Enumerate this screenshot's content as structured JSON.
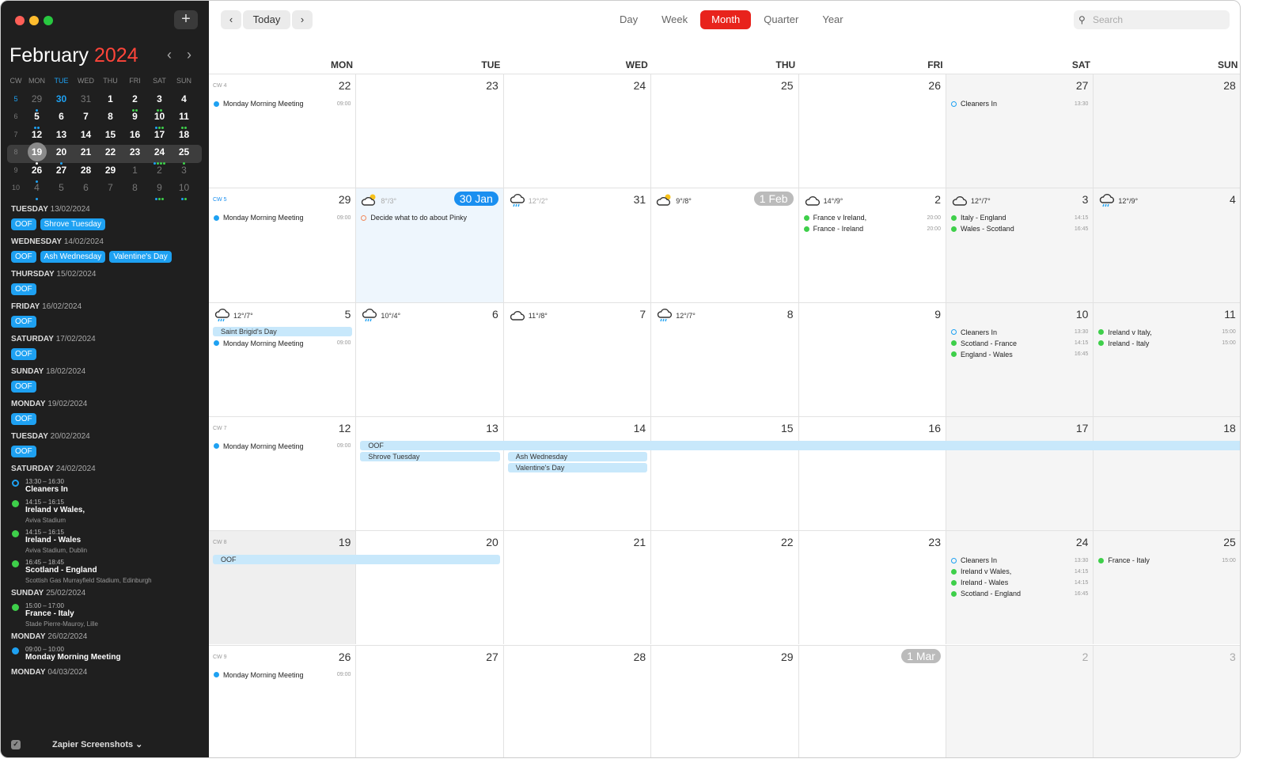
{
  "colors": {
    "accent": "#e8231c",
    "blue": "#1ea1f2",
    "green": "#3ecf4a",
    "orange": "#f08a5d",
    "bar": "#c8e8fb"
  },
  "sidebar": {
    "add_icon": "plus-icon",
    "add_label": "+",
    "month": "February",
    "year": "2024",
    "prev": "‹",
    "next": "›",
    "mini_headers": [
      "CW",
      "MON",
      "TUE",
      "WED",
      "THU",
      "FRI",
      "SAT",
      "SUN"
    ],
    "mini_weeks": [
      {
        "cw": "5",
        "cur": true,
        "days": [
          {
            "n": "29",
            "dim": true,
            "dots": "b"
          },
          {
            "n": "30",
            "cur": true,
            "dots": ""
          },
          {
            "n": "31",
            "dim": true
          },
          {
            "n": "1"
          },
          {
            "n": "2",
            "dots": "gg"
          },
          {
            "n": "3",
            "dots": "gg"
          },
          {
            "n": "4"
          }
        ]
      },
      {
        "cw": "6",
        "days": [
          {
            "n": "5",
            "dots": "bb"
          },
          {
            "n": "6"
          },
          {
            "n": "7"
          },
          {
            "n": "8"
          },
          {
            "n": "9"
          },
          {
            "n": "10",
            "dots": "bgg"
          },
          {
            "n": "11",
            "dots": "gg"
          }
        ]
      },
      {
        "cw": "7",
        "days": [
          {
            "n": "12",
            "dots": "g"
          },
          {
            "n": "13",
            "dots": "bb"
          },
          {
            "n": "14",
            "dots": "bbb"
          },
          {
            "n": "15",
            "dots": "b"
          },
          {
            "n": "16",
            "dots": "b"
          },
          {
            "n": "17",
            "dots": "b"
          },
          {
            "n": "18",
            "dots": "b"
          }
        ]
      },
      {
        "cw": "8",
        "sel": true,
        "days": [
          {
            "n": "19",
            "today": true,
            "dots": "w"
          },
          {
            "n": "20",
            "dots": "b"
          },
          {
            "n": "21"
          },
          {
            "n": "22"
          },
          {
            "n": "23"
          },
          {
            "n": "24",
            "dots": "bggg"
          },
          {
            "n": "25",
            "dots": "g"
          }
        ]
      },
      {
        "cw": "9",
        "days": [
          {
            "n": "26",
            "dots": "b"
          },
          {
            "n": "27"
          },
          {
            "n": "28"
          },
          {
            "n": "29"
          },
          {
            "n": "1",
            "dim": true
          },
          {
            "n": "2",
            "dim": true
          },
          {
            "n": "3",
            "dim": true
          }
        ]
      },
      {
        "cw": "10",
        "days": [
          {
            "n": "4",
            "dim": true,
            "dots": "b"
          },
          {
            "n": "5",
            "dim": true
          },
          {
            "n": "6",
            "dim": true
          },
          {
            "n": "7",
            "dim": true
          },
          {
            "n": "8",
            "dim": true
          },
          {
            "n": "9",
            "dim": true,
            "dots": "bgg"
          },
          {
            "n": "10",
            "dim": true,
            "dots": "bg"
          }
        ]
      }
    ],
    "agenda": [
      {
        "day": "TUESDAY",
        "date": "13/02/2024",
        "chips": [
          "OOF",
          "Shrove Tuesday"
        ]
      },
      {
        "day": "WEDNESDAY",
        "date": "14/02/2024",
        "chips": [
          "OOF",
          "Ash Wednesday",
          "Valentine's Day"
        ]
      },
      {
        "day": "THURSDAY",
        "date": "15/02/2024",
        "chips": [
          "OOF"
        ]
      },
      {
        "day": "FRIDAY",
        "date": "16/02/2024",
        "chips": [
          "OOF"
        ]
      },
      {
        "day": "SATURDAY",
        "date": "17/02/2024",
        "chips": [
          "OOF"
        ]
      },
      {
        "day": "SUNDAY",
        "date": "18/02/2024",
        "chips": [
          "OOF"
        ]
      },
      {
        "day": "MONDAY",
        "date": "19/02/2024",
        "chips": [
          "OOF"
        ]
      },
      {
        "day": "TUESDAY",
        "date": "20/02/2024",
        "chips": [
          "OOF"
        ]
      },
      {
        "day": "SATURDAY",
        "date": "24/02/2024",
        "events": [
          {
            "time": "13:30 – 16:30",
            "title": "Cleaners In",
            "color": "blue",
            "ring": true
          },
          {
            "time": "14:15 – 16:15",
            "title": "Ireland v Wales,",
            "loc": "Aviva Stadium",
            "color": "green"
          },
          {
            "time": "14:15 – 16:15",
            "title": "Ireland - Wales",
            "loc": "Aviva Stadium, Dublin",
            "color": "green"
          },
          {
            "time": "16:45 – 18:45",
            "title": "Scotland - England",
            "loc": "Scottish Gas Murrayfield Stadium, Edinburgh",
            "color": "green"
          }
        ]
      },
      {
        "day": "SUNDAY",
        "date": "25/02/2024",
        "events": [
          {
            "time": "15:00 – 17:00",
            "title": "France - Italy",
            "loc": "Stade Pierre-Mauroy, Lille",
            "color": "green"
          }
        ]
      },
      {
        "day": "MONDAY",
        "date": "26/02/2024",
        "events": [
          {
            "time": "09:00 – 10:00",
            "title": "Monday Morning Meeting",
            "color": "blue"
          }
        ]
      },
      {
        "day": "MONDAY",
        "date": "04/03/2024"
      }
    ],
    "calendar_name": "Zapier Screenshots ⌄"
  },
  "toolbar": {
    "prev": "‹",
    "today": "Today",
    "next": "›",
    "views": [
      "Day",
      "Week",
      "Month",
      "Quarter",
      "Year"
    ],
    "active_view": "Month",
    "search_placeholder": "Search",
    "search_icon": "search-icon"
  },
  "weekdays": [
    "MON",
    "TUE",
    "WED",
    "THU",
    "FRI",
    "SAT",
    "SUN"
  ],
  "weeks": [
    {
      "cw": "CW 4",
      "cells": [
        {
          "n": "22",
          "events": [
            {
              "title": "Monday Morning Meeting",
              "time": "09:00",
              "color": "blue"
            }
          ]
        },
        {
          "n": "23"
        },
        {
          "n": "24"
        },
        {
          "n": "25"
        },
        {
          "n": "26"
        },
        {
          "n": "27",
          "events": [
            {
              "title": "Cleaners In",
              "time": "13:30",
              "color": "blue",
              "ring": true
            }
          ]
        },
        {
          "n": "28"
        }
      ]
    },
    {
      "cw": "CW 5",
      "cur": true,
      "cells": [
        {
          "n": "29",
          "events": [
            {
              "title": "Monday Morning Meeting",
              "time": "09:00",
              "color": "blue"
            }
          ]
        },
        {
          "n": "30 Jan",
          "badge": "blue",
          "today": true,
          "wx": {
            "icon": "partly-sunny",
            "temp": "8°/3°",
            "dim": true
          },
          "events": [
            {
              "title": "Decide what to do about Pinky",
              "color": "orange",
              "ring": true
            }
          ]
        },
        {
          "n": "31",
          "wx": {
            "icon": "rain",
            "temp": "12°/2°",
            "dim": true
          }
        },
        {
          "n": "1 Feb",
          "badge": "gray",
          "wx": {
            "icon": "partly-sunny",
            "temp": "9°/8°"
          }
        },
        {
          "n": "2",
          "wx": {
            "icon": "cloud",
            "temp": "14°/9°"
          },
          "events": [
            {
              "title": "France v Ireland,",
              "time": "20:00",
              "color": "green"
            },
            {
              "title": "France - Ireland",
              "time": "20:00",
              "color": "green"
            }
          ]
        },
        {
          "n": "3",
          "wx": {
            "icon": "cloud",
            "temp": "12°/7°"
          },
          "events": [
            {
              "title": "Italy - England",
              "time": "14:15",
              "color": "green"
            },
            {
              "title": "Wales - Scotland",
              "time": "16:45",
              "color": "green"
            }
          ]
        },
        {
          "n": "4",
          "wx": {
            "icon": "rain",
            "temp": "12°/9°"
          }
        }
      ]
    },
    {
      "cw": "",
      "cells": [
        {
          "n": "5",
          "wx": {
            "icon": "rain",
            "temp": "12°/7°"
          },
          "skip": 1,
          "events": [
            {
              "title": "Monday Morning Meeting",
              "time": "09:00",
              "color": "blue"
            }
          ]
        },
        {
          "n": "6",
          "wx": {
            "icon": "rain",
            "temp": "10°/4°"
          }
        },
        {
          "n": "7",
          "wx": {
            "icon": "cloud",
            "temp": "11°/8°"
          }
        },
        {
          "n": "8",
          "wx": {
            "icon": "rain",
            "temp": "12°/7°"
          }
        },
        {
          "n": "9"
        },
        {
          "n": "10",
          "events": [
            {
              "title": "Cleaners In",
              "time": "13:30",
              "color": "blue",
              "ring": true
            },
            {
              "title": "Scotland - France",
              "time": "14:15",
              "color": "green"
            },
            {
              "title": "England - Wales",
              "time": "16:45",
              "color": "green"
            }
          ]
        },
        {
          "n": "11",
          "events": [
            {
              "title": "Ireland v Italy,",
              "time": "15:00",
              "color": "green"
            },
            {
              "title": "Ireland - Italy",
              "time": "15:00",
              "color": "green"
            }
          ]
        }
      ],
      "bars": [
        {
          "title": "Saint Brigid's Day",
          "start": 0,
          "span": 1,
          "slot": 0
        }
      ]
    },
    {
      "cw": "CW 7",
      "cells": [
        {
          "n": "12",
          "events": [
            {
              "title": "Monday Morning Meeting",
              "time": "09:00",
              "color": "blue"
            }
          ]
        },
        {
          "n": "13"
        },
        {
          "n": "14"
        },
        {
          "n": "15"
        },
        {
          "n": "16"
        },
        {
          "n": "17"
        },
        {
          "n": "18"
        }
      ],
      "bars": [
        {
          "title": "OOF",
          "start": 1,
          "span": 6,
          "slot": 0
        },
        {
          "title": "Shrove Tuesday",
          "start": 1,
          "span": 1,
          "slot": 1
        },
        {
          "title": "Ash Wednesday",
          "start": 2,
          "span": 1,
          "slot": 1
        },
        {
          "title": "Valentine's Day",
          "start": 2,
          "span": 1,
          "slot": 2
        }
      ]
    },
    {
      "cw": "CW 8",
      "cells": [
        {
          "n": "19",
          "sel": true
        },
        {
          "n": "20"
        },
        {
          "n": "21"
        },
        {
          "n": "22"
        },
        {
          "n": "23"
        },
        {
          "n": "24",
          "events": [
            {
              "title": "Cleaners In",
              "time": "13:30",
              "color": "blue",
              "ring": true
            },
            {
              "title": "Ireland v Wales,",
              "time": "14:15",
              "color": "green"
            },
            {
              "title": "Ireland - Wales",
              "time": "14:15",
              "color": "green"
            },
            {
              "title": "Scotland - England",
              "time": "16:45",
              "color": "green"
            }
          ]
        },
        {
          "n": "25",
          "events": [
            {
              "title": "France - Italy",
              "time": "15:00",
              "color": "green"
            }
          ]
        }
      ],
      "bars": [
        {
          "title": "OOF",
          "start": 0,
          "span": 2,
          "slot": 0
        }
      ]
    },
    {
      "cw": "CW 9",
      "cells": [
        {
          "n": "26",
          "events": [
            {
              "title": "Monday Morning Meeting",
              "time": "09:00",
              "color": "blue"
            }
          ]
        },
        {
          "n": "27"
        },
        {
          "n": "28"
        },
        {
          "n": "29"
        },
        {
          "n": "1 Mar",
          "badge": "gray"
        },
        {
          "n": "2",
          "dim": true
        },
        {
          "n": "3",
          "dim": true
        }
      ]
    }
  ]
}
